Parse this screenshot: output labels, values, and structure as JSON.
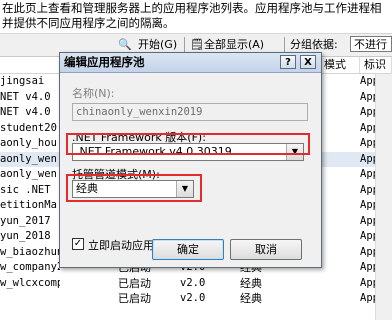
{
  "description": {
    "line1": "在此页上查看和管理服务器上的应用程序池列表。应用程序池与工作进程相",
    "line2": "并提供不同应用程序之间的隔离。"
  },
  "toolbar": {
    "start_label": "开始(G)",
    "show_all_label": "全部显示(A)",
    "group_by_label": "分组依据:",
    "group_by_value": "不进行"
  },
  "columns": {
    "name": "名称",
    "mode": "模式",
    "identity": "标识"
  },
  "rows": [
    {
      "name": "jingsai",
      "status": "",
      "version": "",
      "mode": "",
      "identity": "Applic"
    },
    {
      "name": "NET v4.0",
      "status": "",
      "version": "",
      "mode": "",
      "identity": "Applic"
    },
    {
      "name": "NET v4.0",
      "status": "",
      "version": "",
      "mode": "",
      "identity": "Applic"
    },
    {
      "name": "student20",
      "status": "",
      "version": "",
      "mode": "",
      "identity": "Applic"
    },
    {
      "name": "aonly_hou",
      "status": "",
      "version": "",
      "mode": "",
      "identity": "Applic"
    },
    {
      "name": "aonly_wen",
      "status": "",
      "version": "",
      "mode": "",
      "identity": "Applic"
    },
    {
      "name": "aonly_wen",
      "status": "",
      "version": "",
      "mode": "",
      "identity": "Applic"
    },
    {
      "name": "sic .NET",
      "status": "",
      "version": "",
      "mode": "",
      "identity": "Applic"
    },
    {
      "name": "etitionMa",
      "status": "",
      "version": "",
      "mode": "",
      "identity": "Applic"
    },
    {
      "name": "yun_2017",
      "status": "",
      "version": "",
      "mode": "",
      "identity": "Applic"
    },
    {
      "name": "yun_2018",
      "status": "",
      "version": "",
      "mode": "",
      "identity": "Applic"
    },
    {
      "name": "w_biaozhun",
      "status": "",
      "version": "",
      "mode": "",
      "identity": "Applic"
    },
    {
      "name": "w_company2",
      "status": "已启动",
      "version": "v2.0",
      "mode": "经典",
      "identity": "Applic"
    },
    {
      "name": "w_wlcxcompany6",
      "status": "已启动",
      "version": "v2.0",
      "mode": "经典",
      "identity": "Applic"
    },
    {
      "name": "",
      "status": "已启动",
      "version": "v2.0",
      "mode": "经典",
      "identity": "Applic"
    }
  ],
  "dialog": {
    "title": "编辑应用程序池",
    "help_button": "?",
    "close_button": "X",
    "name_label": "名称(N):",
    "name_value": "chinaonly_wenxin2019",
    "framework_label": ".NET Framework 版本(F):",
    "framework_value": ".NET Framework v4.0.30319",
    "pipeline_label": "托管管道模式(M):",
    "pipeline_value": "经典",
    "autostart_label": "立即启动应用程序池",
    "autostart_checked": "✓",
    "ok_label": "确定",
    "cancel_label": "取消",
    "highlight_color": "#e32b2b"
  }
}
